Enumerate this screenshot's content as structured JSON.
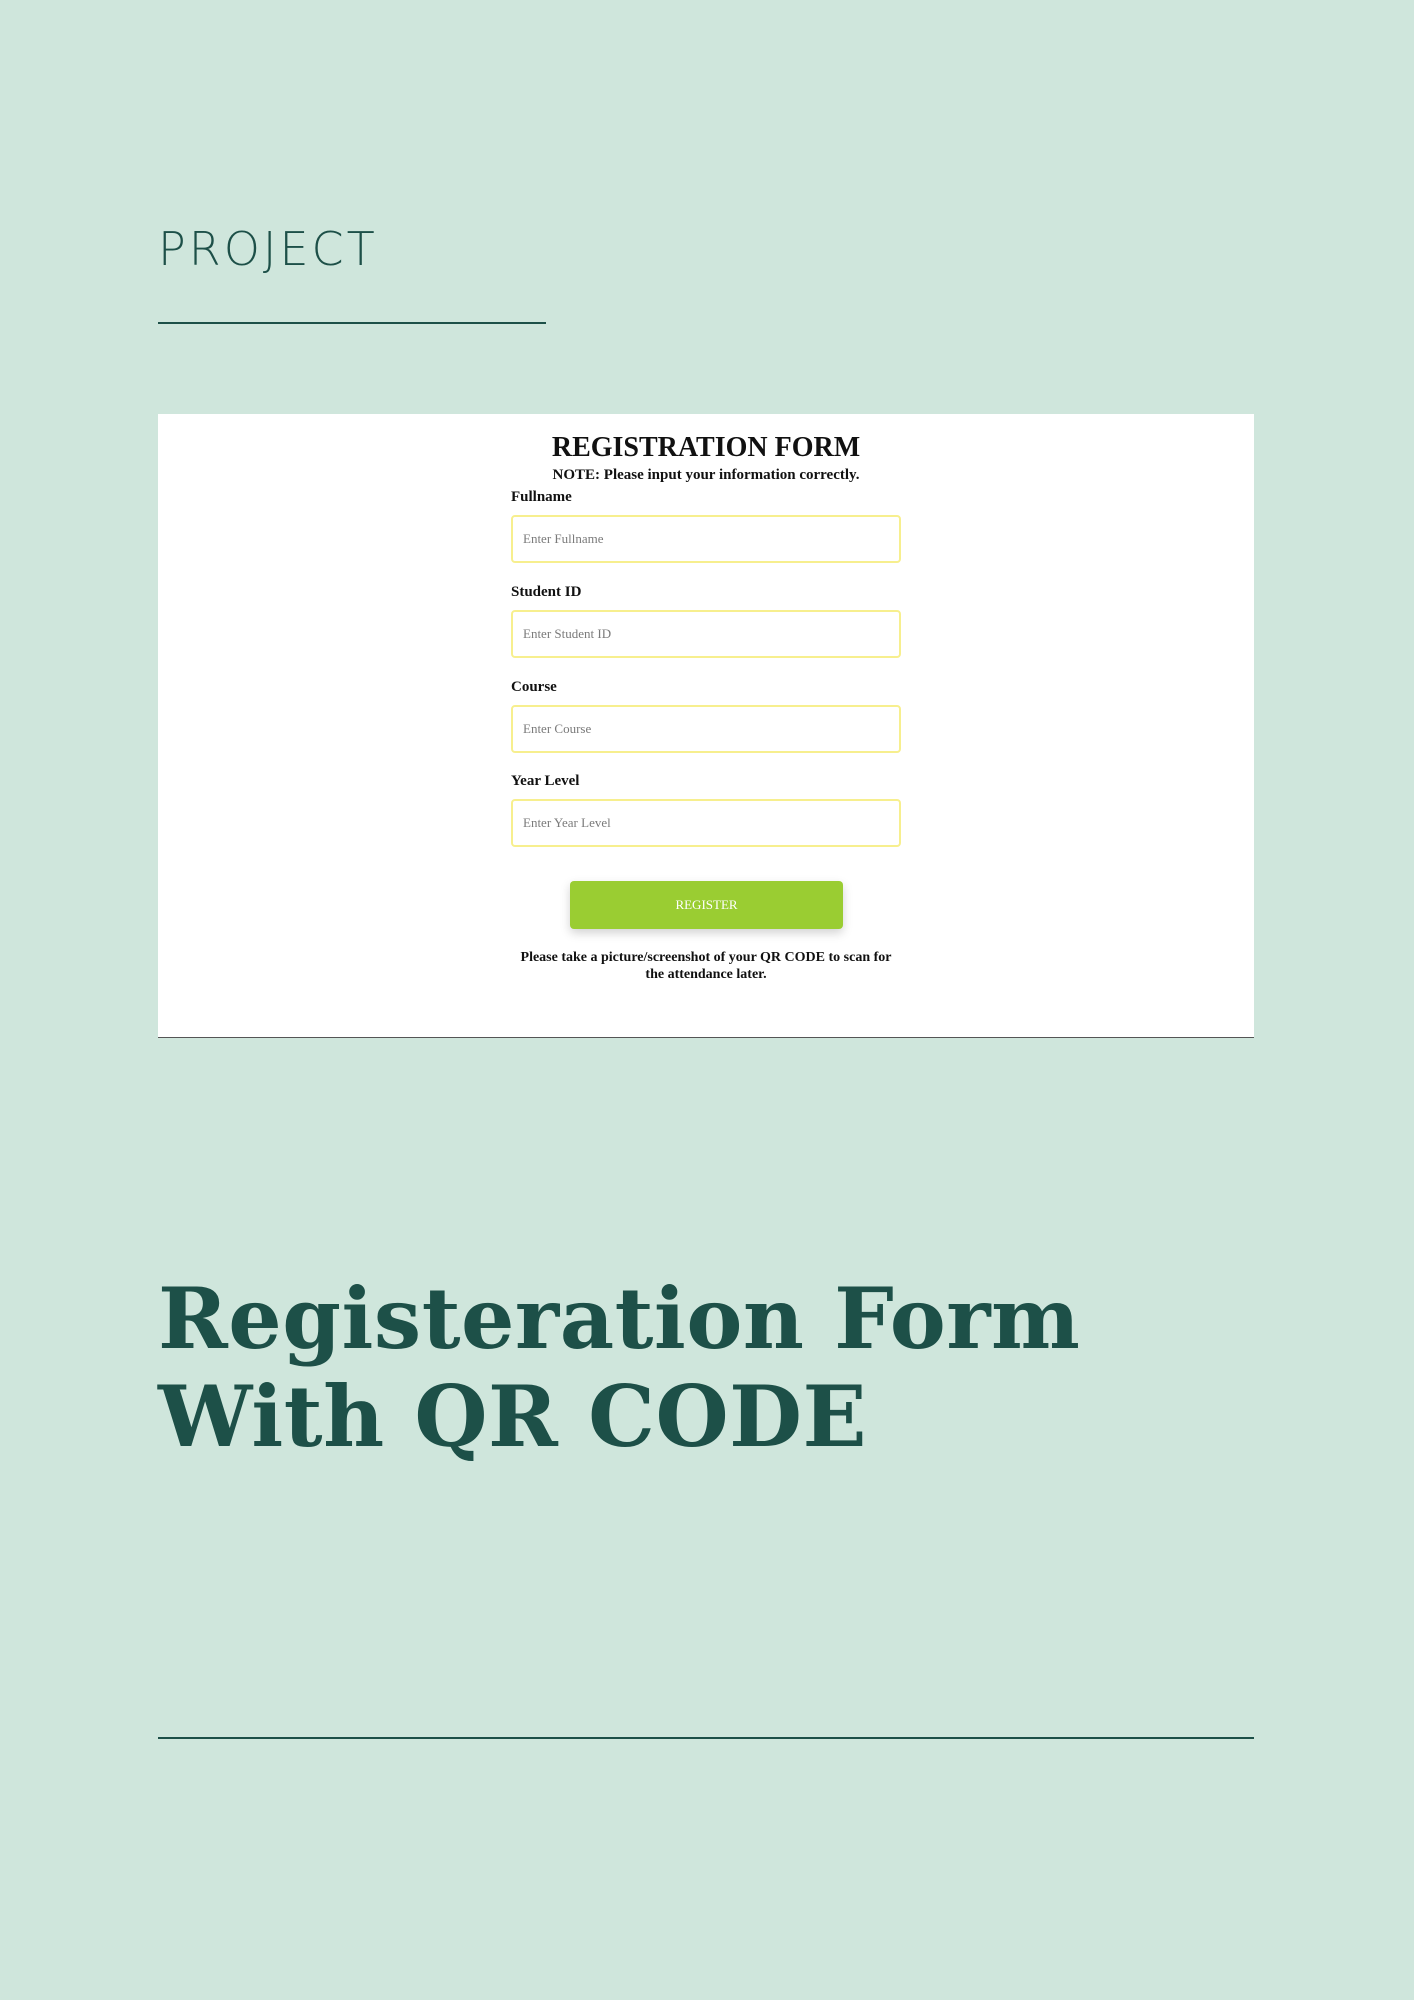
{
  "section_label": "PROJECT",
  "form": {
    "title": "REGISTRATION FORM",
    "note": "NOTE: Please input your information correctly.",
    "fields": [
      {
        "label": "Fullname",
        "placeholder": "Enter Fullname"
      },
      {
        "label": "Student ID",
        "placeholder": "Enter Student ID"
      },
      {
        "label": "Course",
        "placeholder": "Enter Course"
      },
      {
        "label": "Year Level",
        "placeholder": "Enter Year Level"
      }
    ],
    "register_label": "REGISTER",
    "qr_note": "Please take a picture/screenshot of your QR CODE to scan for the attendance later."
  },
  "heading": "Registeration Form With QR CODE",
  "colors": {
    "background": "#cfe6dc",
    "accent_dark_green": "#1d5048",
    "button_green": "#9acd32",
    "input_border_yellow": "#f7ef8e"
  }
}
